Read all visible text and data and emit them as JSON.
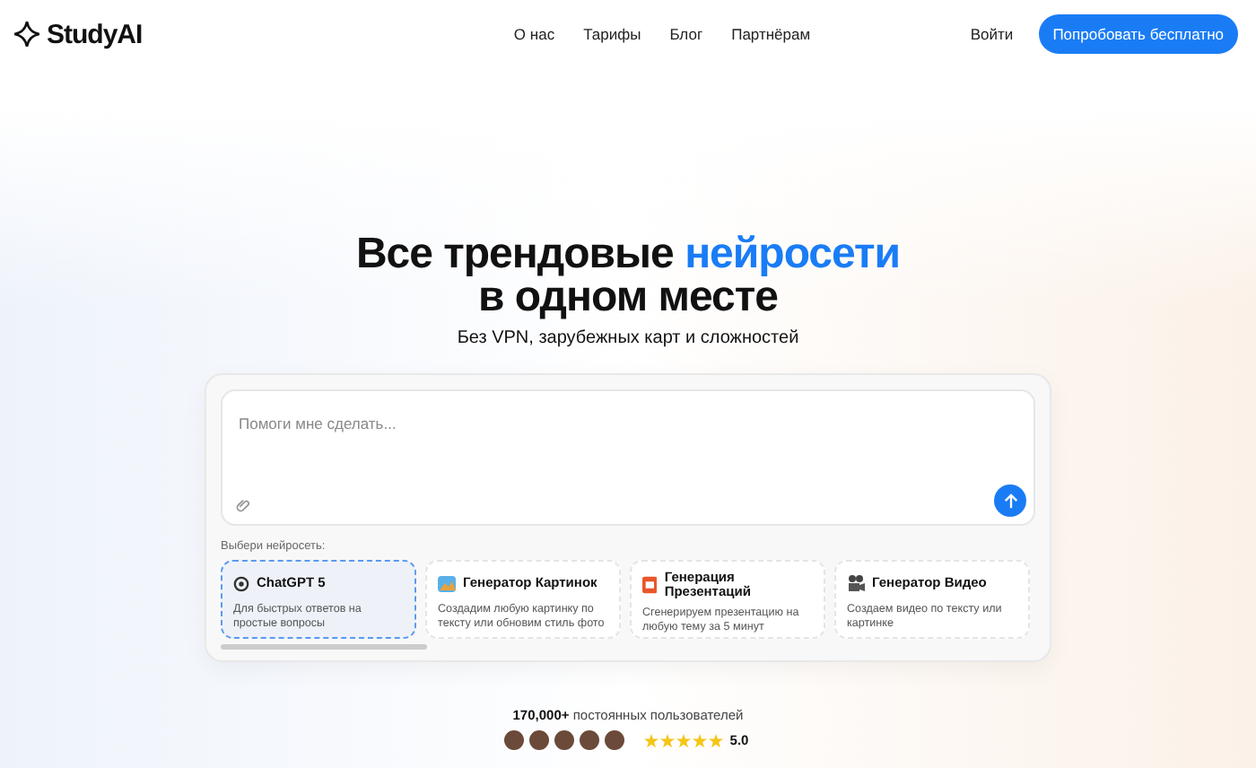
{
  "header": {
    "logo": "StudyAI",
    "nav": [
      "О нас",
      "Тарифы",
      "Блог",
      "Партнёрам"
    ],
    "login": "Войти",
    "cta": "Попробовать бесплатно"
  },
  "hero": {
    "title_start": "Все трендовые ",
    "title_accent": "нейросети",
    "title_end": "в одном месте",
    "subtitle": "Без VPN, зарубежных карт и сложностей"
  },
  "prompt": {
    "placeholder": "Помоги мне сделать...",
    "models_label": "Выбери нейросеть:",
    "models": [
      {
        "kind": "chat",
        "name": "ChatGPT 5",
        "description": "Для быстрых ответов на простые вопросы",
        "selected": true
      },
      {
        "kind": "image",
        "name": "Генератор Картинок",
        "description": "Создадим любую картинку по тексту или обновим стиль фото",
        "selected": false
      },
      {
        "kind": "slides",
        "name": "Генерация Презентаций",
        "description": "Сгенерируем презентацию  на любую тему за 5 минут",
        "selected": false
      },
      {
        "kind": "video",
        "name": "Генератор Видео",
        "description": "Создаем видео по тексту или картинке",
        "selected": false
      }
    ]
  },
  "social": {
    "users": "**170,000+** постоянных пользователей",
    "stars": 5,
    "rating": "5.0"
  }
}
